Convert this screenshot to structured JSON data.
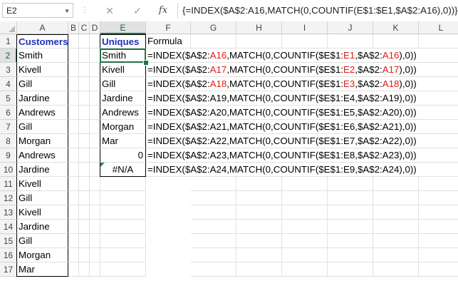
{
  "formula_bar": {
    "name_box": "E2",
    "cancel_icon": "✕",
    "enter_icon": "✓",
    "fx_label": "fx",
    "formula": "{=INDEX($A$2:A16,MATCH(0,COUNTIF(E$1:$E1,$A$2:A16),0))}"
  },
  "columns": [
    "A",
    "B",
    "C",
    "D",
    "E",
    "F",
    "G",
    "H",
    "I",
    "J",
    "K",
    "L"
  ],
  "rows": [
    "1",
    "2",
    "3",
    "4",
    "5",
    "6",
    "7",
    "8",
    "9",
    "10",
    "11",
    "12",
    "13",
    "14",
    "15",
    "16",
    "17"
  ],
  "colA": [
    "Customers",
    "Smith",
    "Kivell",
    "Gill",
    "Jardine",
    "Andrews",
    "Gill",
    "Morgan",
    "Andrews",
    "Jardine",
    "Kivell",
    "Gill",
    "Kivell",
    "Jardine",
    "Gill",
    "Morgan",
    "Mar"
  ],
  "colE": [
    "Uniques",
    "Smith",
    "Kivell",
    "Gill",
    "Jardine",
    "Andrews",
    "Morgan",
    "Mar",
    "0",
    "#N/A"
  ],
  "colF_header": "Formula",
  "formulas": [
    {
      "p1": "=INDEX($A$2:",
      "r1": "A16",
      "p2": ",MATCH(0,COUNTIF($E$1:",
      "r2": "E1",
      "p3": ",$A$2:",
      "r3": "A16",
      "p4": "),0))"
    },
    {
      "p1": "=INDEX($A$2:",
      "r1": "A17",
      "p2": ",MATCH(0,COUNTIF($E$1:",
      "r2": "E2",
      "p3": ",$A$2:",
      "r3": "A17",
      "p4": "),0))"
    },
    {
      "p1": "=INDEX($A$2:",
      "r1": "A18",
      "p2": ",MATCH(0,COUNTIF($E$1:",
      "r2": "E3",
      "p3": ",$A$2:",
      "r3": "A18",
      "p4": "),0))"
    },
    {
      "p1": "=INDEX($A$2:A19,MATCH(0,COUNTIF($E$1:E4,$A$2:A19),0))",
      "r1": "",
      "p2": "",
      "r2": "",
      "p3": "",
      "r3": "",
      "p4": ""
    },
    {
      "p1": "=INDEX($A$2:A20,MATCH(0,COUNTIF($E$1:E5,$A$2:A20),0))",
      "r1": "",
      "p2": "",
      "r2": "",
      "p3": "",
      "r3": "",
      "p4": ""
    },
    {
      "p1": "=INDEX($A$2:A21,MATCH(0,COUNTIF($E$1:E6,$A$2:A21),0))",
      "r1": "",
      "p2": "",
      "r2": "",
      "p3": "",
      "r3": "",
      "p4": ""
    },
    {
      "p1": "=INDEX($A$2:A22,MATCH(0,COUNTIF($E$1:E7,$A$2:A22),0))",
      "r1": "",
      "p2": "",
      "r2": "",
      "p3": "",
      "r3": "",
      "p4": ""
    },
    {
      "p1": "=INDEX($A$2:A23,MATCH(0,COUNTIF($E$1:E8,$A$2:A23),0))",
      "r1": "",
      "p2": "",
      "r2": "",
      "p3": "",
      "r3": "",
      "p4": ""
    },
    {
      "p1": "=INDEX($A$2:A24,MATCH(0,COUNTIF($E$1:E9,$A$2:A24),0))",
      "r1": "",
      "p2": "",
      "r2": "",
      "p3": "",
      "r3": "",
      "p4": ""
    }
  ],
  "colors": {
    "header_blue": "#1f2fb8",
    "ref_red": "#e21b1b",
    "select_green": "#217346"
  }
}
